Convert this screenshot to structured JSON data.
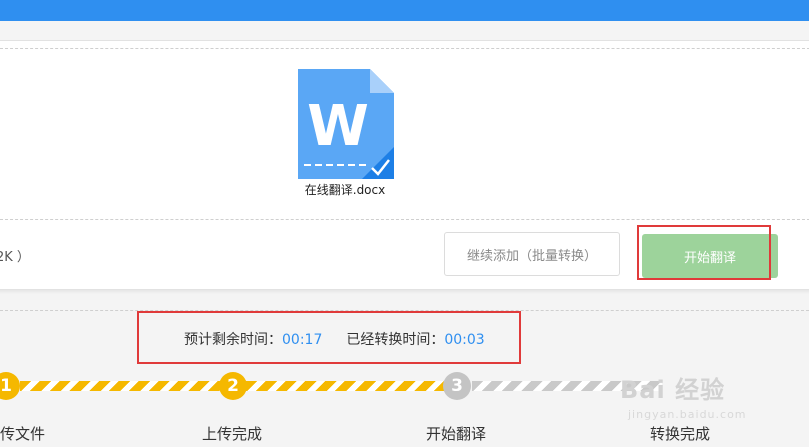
{
  "file": {
    "name": "在线翻译.docx",
    "icon": "word-doc-icon",
    "letter": "W"
  },
  "size_text": "2K ）",
  "buttons": {
    "continue_add": "继续添加（批量转换）",
    "start_translate": "开始翻译"
  },
  "timing": {
    "remaining_label": "预计剩余时间：",
    "remaining_value": "00:17",
    "elapsed_label": "已经转换时间：",
    "elapsed_value": "00:03"
  },
  "steps": [
    {
      "number": "1",
      "label": "传文件",
      "status": "done"
    },
    {
      "number": "2",
      "label": "上传完成",
      "status": "done"
    },
    {
      "number": "3",
      "label": "开始翻译",
      "status": "pending"
    },
    {
      "number": "",
      "label": "转换完成",
      "status": "pending"
    }
  ],
  "watermark": {
    "text": "Bai 经验",
    "sub": "jingyan.baidu.com"
  },
  "colors": {
    "topbar": "#2f8ff0",
    "accent_blue": "#2f8ff0",
    "start_button": "#9dd39b",
    "highlight_red": "#e03a3a",
    "step_done": "#f5b800",
    "step_pending": "#c4c4c4"
  }
}
